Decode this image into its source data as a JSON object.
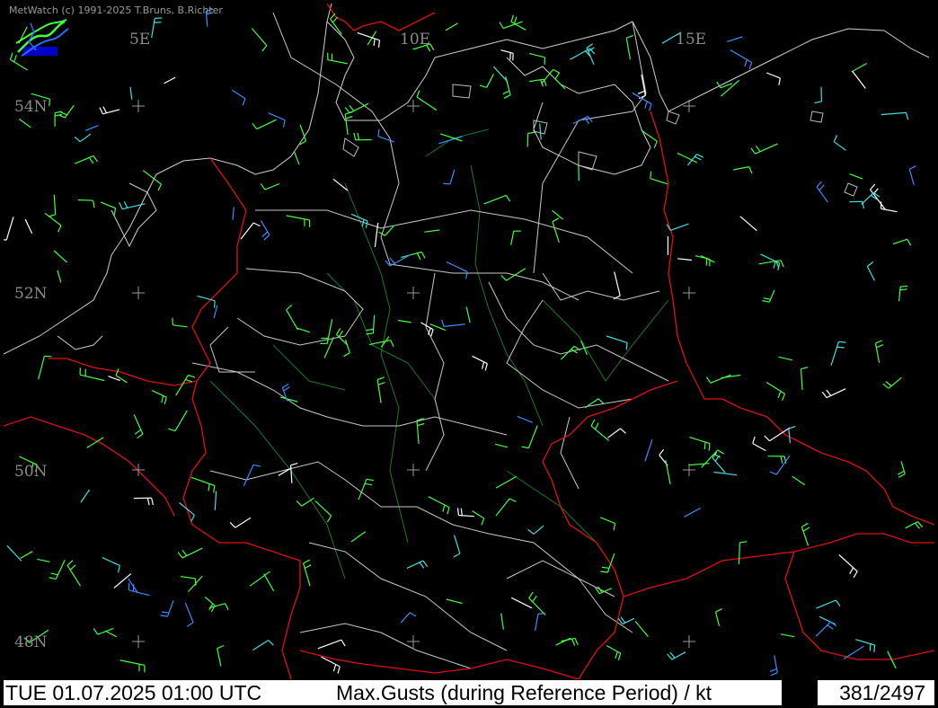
{
  "credit": "MetWatch  (c) 1991-2025 T.Bruns, B.Richter",
  "status": {
    "datetime": "TUE 01.07.2025 01:00 UTC",
    "title": "Max.Gusts (during Reference Period) / kt",
    "counter": "381/2497"
  },
  "map": {
    "longitude_labels": [
      "5E",
      "10E",
      "15E"
    ],
    "latitude_labels": [
      "54N",
      "52N",
      "50N",
      "48N"
    ]
  },
  "colors": {
    "background": "#000000",
    "coast": "#d0d0d0",
    "country_border": "#e01010",
    "state_border": "#c8c8c8",
    "rivers": "#1e7a1e",
    "wind_calm": "#ffffff",
    "wind_light": "#40ff40",
    "wind_moderate": "#3c8cff",
    "wind_strong": "#40e0e0"
  }
}
